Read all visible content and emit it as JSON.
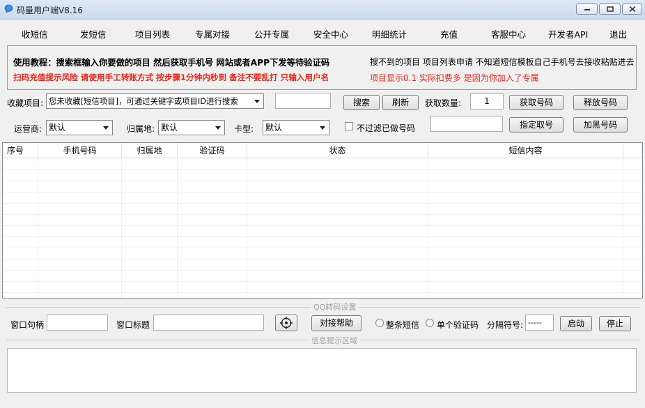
{
  "window": {
    "title": "码量用户端V8.16"
  },
  "menu": [
    "收短信",
    "发短信",
    "项目列表",
    "专属对接",
    "公开专属",
    "安全中心",
    "明细统计",
    "充值",
    "客服中心",
    "开发者API",
    "退出"
  ],
  "tutorial": {
    "line1_left": "使用教程：搜索框输入你要做的项目 然后获取手机号 网站或者APP下发等待验证码",
    "line1_right": "搜不到的项目 项目列表申请 不知道短信模板自己手机号去接收粘贴进去",
    "line2_left": "扫码充值提示风险 请使用手工转账方式 按步骤1分钟内秒到 备注不要乱打 只输入用户名",
    "line2_right": "项目显示0.1 实际扣费多 是因为你加入了专属",
    "red_color": "#e8261a"
  },
  "controls": {
    "fav_label": "收藏项目:",
    "fav_value": "您未收藏[短信项目]，可通过关键字或项目ID进行搜索",
    "search_value": "",
    "search_btn": "搜索",
    "refresh_btn": "刷新",
    "qty_label": "获取数量:",
    "qty_value": "1",
    "get_btn": "获取号码",
    "release_btn": "释放号码",
    "carrier_label": "运营商:",
    "carrier_value": "默认",
    "region_label": "归属地:",
    "region_value": "默认",
    "cardtype_label": "卡型:",
    "cardtype_value": "默认",
    "nofilter_label": "不过滤已做号码",
    "specify_input": "",
    "specify_btn": "指定取号",
    "blacklist_btn": "加黑号码"
  },
  "table": {
    "columns": [
      "序号",
      "手机号码",
      "归属地",
      "验证码",
      "状态",
      "短信内容"
    ],
    "rows": []
  },
  "qq": {
    "group_title": "QQ转码设置",
    "handle_label": "窗口句柄",
    "handle_value": "",
    "wtitle_label": "窗口标题",
    "wtitle_value": "",
    "help_btn": "对接帮助",
    "radio_all": "整条短信",
    "radio_single": "单个验证码",
    "sep_label": "分隔符号:",
    "sep_value": "-----",
    "start_btn": "启动",
    "stop_btn": "停止"
  },
  "info": {
    "group_title": "信息提示区域",
    "text": ""
  }
}
